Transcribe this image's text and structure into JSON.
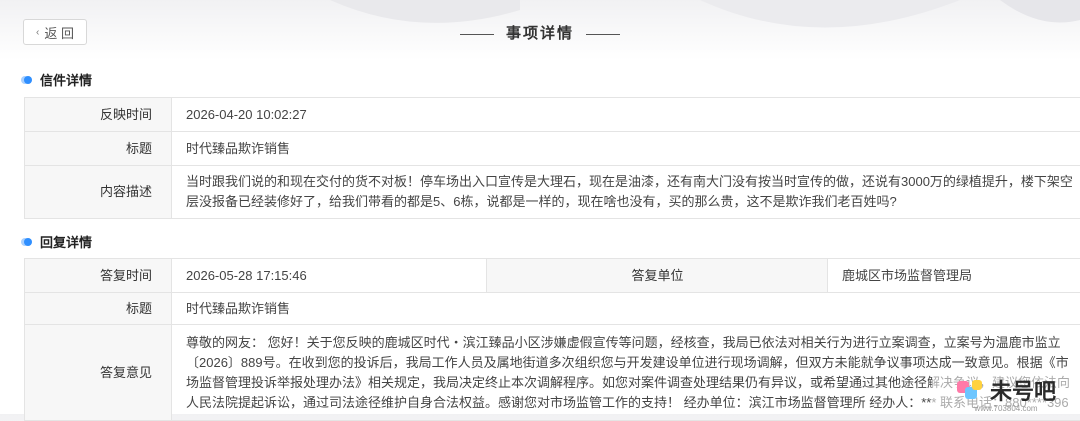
{
  "header": {
    "back_label": "返 回",
    "title": "事项详情"
  },
  "letter": {
    "section_title": "信件详情",
    "rows": [
      {
        "label": "反映时间",
        "value": "2026-04-20 10:02:27"
      },
      {
        "label": "标题",
        "value": "时代臻品欺诈销售"
      },
      {
        "label": "内容描述",
        "value": "当时跟我们说的和现在交付的货不对板！停车场出入口宣传是大理石，现在是油漆，还有南大门没有按当时宣传的做，还说有3000万的绿植提升，楼下架空层没报备已经装修好了，给我们带看的都是5、6栋，说都是一样的，现在啥也没有，买的那么贵，这不是欺诈我们老百姓吗?"
      }
    ]
  },
  "reply": {
    "section_title": "回复详情",
    "time_label": "答复时间",
    "time_value": "2026-05-28 17:15:46",
    "unit_label": "答复单位",
    "unit_value": "鹿城区市场监督管理局",
    "title_label": "标题",
    "title_value": "时代臻品欺诈销售",
    "opinion_label": "答复意见",
    "opinion_value": "尊敬的网友：  您好！关于您反映的鹿城区时代・滨江臻品小区涉嫌虚假宣传等问题，经核查，我局已依法对相关行为进行立案调查，立案号为温鹿市监立〔2026〕889号。在收到您的投诉后，我局工作人员及属地街道多次组织您与开发建设单位进行现场调解，但双方未能就争议事项达成一致意见。根据《市场监督管理投诉举报处理办法》相关规定，我局决定终止本次调解程序。如您对案件调查处理结果仍有异议，或希望通过其他途径解决争议，建议您依法向人民法院提起诉讼，通过司法途径维护自身合法权益。感谢您对市场监管工作的支持！  经办单位：滨江市场监督管理所 经办人：*** 联系电话：880****396"
  },
  "watermark": {
    "logo_text": "未号吧",
    "url": "www.703804.com"
  }
}
